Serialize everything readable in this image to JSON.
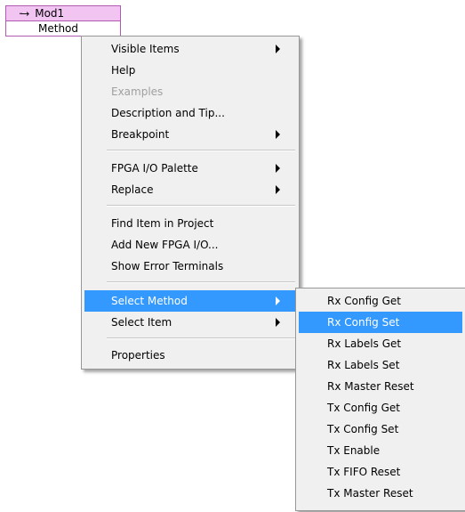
{
  "node": {
    "name": "Mod1",
    "method_label": "Method"
  },
  "context_menu": {
    "items": [
      {
        "label": "Visible Items",
        "submenu": true
      },
      {
        "label": "Help"
      },
      {
        "label": "Examples",
        "disabled": true
      },
      {
        "label": "Description and Tip..."
      },
      {
        "label": "Breakpoint",
        "submenu": true
      },
      {
        "label": "FPGA I/O Palette",
        "submenu": true
      },
      {
        "label": "Replace",
        "submenu": true
      },
      {
        "label": "Find Item in Project"
      },
      {
        "label": "Add New FPGA I/O..."
      },
      {
        "label": "Show Error Terminals"
      },
      {
        "label": "Select Method",
        "submenu": true,
        "highlighted": true
      },
      {
        "label": "Select Item",
        "submenu": true
      },
      {
        "label": "Properties"
      }
    ]
  },
  "method_submenu": {
    "items": [
      {
        "label": "Rx Config Get"
      },
      {
        "label": "Rx Config Set",
        "highlighted": true
      },
      {
        "label": "Rx Labels Get"
      },
      {
        "label": "Rx Labels Set"
      },
      {
        "label": "Rx Master Reset"
      },
      {
        "label": "Tx Config Get"
      },
      {
        "label": "Tx Config Set"
      },
      {
        "label": "Tx Enable"
      },
      {
        "label": "Tx FIFO Reset"
      },
      {
        "label": "Tx Master Reset"
      }
    ]
  },
  "colors": {
    "highlight": "#3399ff",
    "node_fill": "#f2c4f2",
    "node_border": "#b05ab0",
    "menu_bg": "#f0f0f0",
    "disabled_text": "#a0a0a0"
  }
}
